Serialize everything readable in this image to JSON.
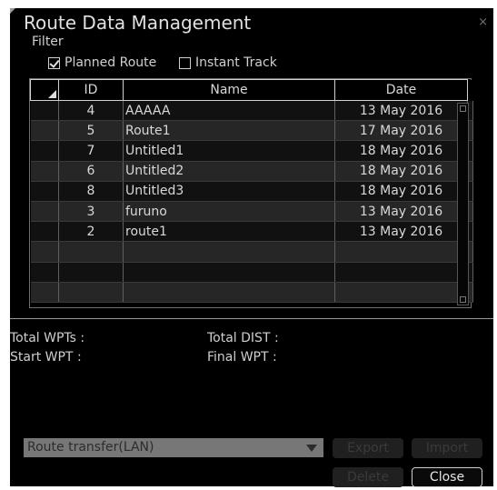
{
  "window": {
    "title": "Route Data Management",
    "close_glyph": "×"
  },
  "filter": {
    "label": "Filter",
    "planned_route": {
      "label": "Planned Route",
      "checked": true
    },
    "instant_track": {
      "label": "Instant Track",
      "checked": false
    }
  },
  "table": {
    "columns": [
      "ID",
      "Name",
      "Date"
    ],
    "rows": [
      {
        "id": "4",
        "name": "AAAAA",
        "date": "13 May 2016"
      },
      {
        "id": "5",
        "name": "Route1",
        "date": "17 May 2016"
      },
      {
        "id": "7",
        "name": "Untitled1",
        "date": "18 May 2016"
      },
      {
        "id": "6",
        "name": "Untitled2",
        "date": "18 May 2016"
      },
      {
        "id": "8",
        "name": "Untitled3",
        "date": "18 May 2016"
      },
      {
        "id": "3",
        "name": "furuno",
        "date": "13 May 2016"
      },
      {
        "id": "2",
        "name": "route1",
        "date": "13 May 2016"
      },
      {
        "id": "",
        "name": "",
        "date": ""
      },
      {
        "id": "",
        "name": "",
        "date": ""
      },
      {
        "id": "",
        "name": "",
        "date": ""
      }
    ]
  },
  "info": {
    "total_wpts": "Total WPTs :",
    "total_dist": "Total DIST :",
    "start_wpt": "Start WPT :",
    "final_wpt": "Final WPT :"
  },
  "transfer": {
    "selected": "Route transfer(LAN)"
  },
  "buttons": {
    "export": "Export",
    "import": "Import",
    "delete": "Delete",
    "close": "Close"
  },
  "colors": {
    "window_bg": "#000000",
    "row_dark": "#111111",
    "row_light": "#262626",
    "dropdown_bg": "#777777"
  }
}
